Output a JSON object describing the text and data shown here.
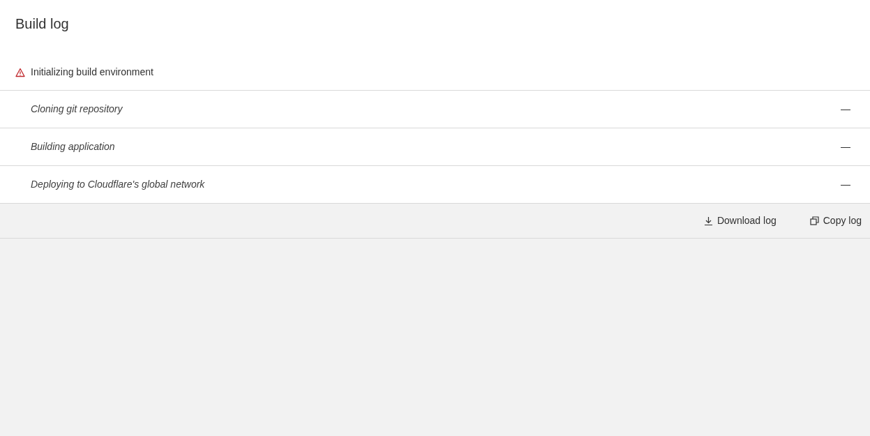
{
  "title": "Build log",
  "steps": [
    {
      "label": "Initializing build environment",
      "kind": "error"
    },
    {
      "label": "Cloning git repository",
      "kind": "pending",
      "duration": "—"
    },
    {
      "label": "Building application",
      "kind": "pending",
      "duration": "—"
    },
    {
      "label": "Deploying to Cloudflare's global network",
      "kind": "pending",
      "duration": "—"
    }
  ],
  "actions": [
    {
      "label": "Download log",
      "kind": "download"
    },
    {
      "label": "Copy log",
      "kind": "copy"
    }
  ]
}
